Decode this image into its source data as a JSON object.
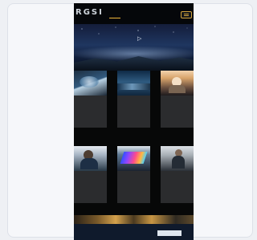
{
  "site": {
    "logo": "RGSI",
    "menu_icon": "hamburger-menu-icon"
  },
  "nav": {
    "items": [
      "",
      "",
      "",
      "",
      ""
    ]
  },
  "hero": {
    "headline": "",
    "sub": "",
    "mark": "▷"
  },
  "tiles": [
    {
      "title": "",
      "body": ""
    },
    {
      "title": "",
      "body": ""
    },
    {
      "title": "",
      "body": ""
    },
    {
      "title": "",
      "body": ""
    },
    {
      "title": "",
      "body": ""
    },
    {
      "title": "",
      "body": ""
    }
  ],
  "strip": {
    "label": ""
  },
  "footer": {
    "heading": "",
    "paragraph": "",
    "badge": ""
  },
  "colors": {
    "page_bg": "#eef0f4",
    "phone_bg": "#0b0d12",
    "accent_blue": "#58b4ea",
    "accent_gold": "#d3a43d"
  }
}
